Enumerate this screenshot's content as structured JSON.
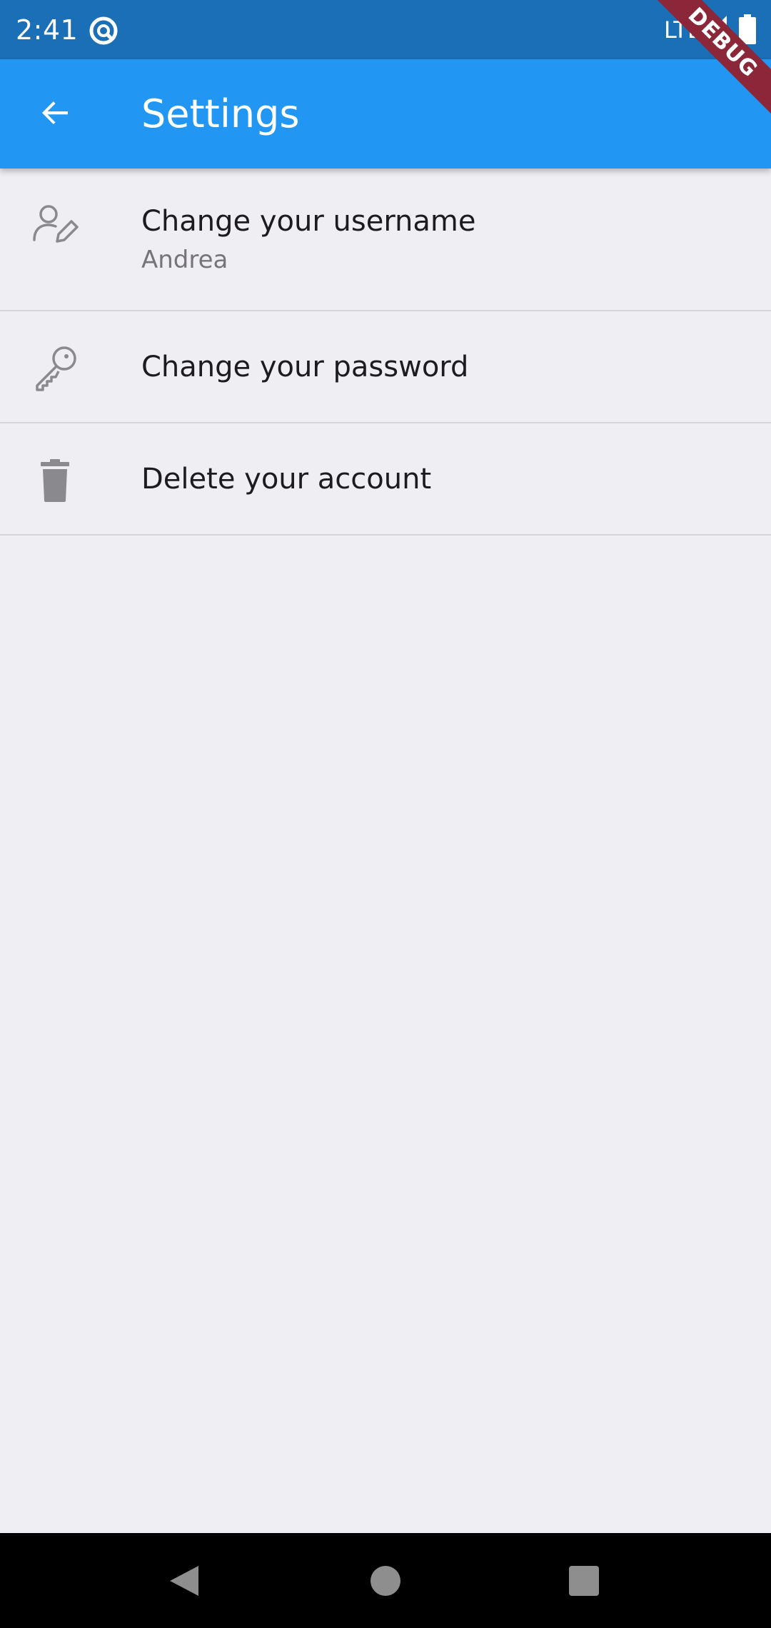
{
  "status_bar": {
    "time": "2:41",
    "network": "LTE",
    "sync_icon": "sync-icon",
    "signal_icon": "signal-icon",
    "battery_icon": "battery-icon"
  },
  "debug_banner": "DEBUG",
  "app_bar": {
    "title": "Settings",
    "back_icon": "arrow-back-icon",
    "color": "#2196F3"
  },
  "settings": {
    "items": [
      {
        "title": "Change your username",
        "subtitle": "Andrea",
        "icon": "user-edit-icon"
      },
      {
        "title": "Change your password",
        "icon": "key-icon"
      },
      {
        "title": "Delete your account",
        "icon": "trash-icon"
      }
    ]
  },
  "nav_bar": {
    "back_icon": "nav-back-icon",
    "home_icon": "nav-home-icon",
    "recents_icon": "nav-recents-icon"
  }
}
